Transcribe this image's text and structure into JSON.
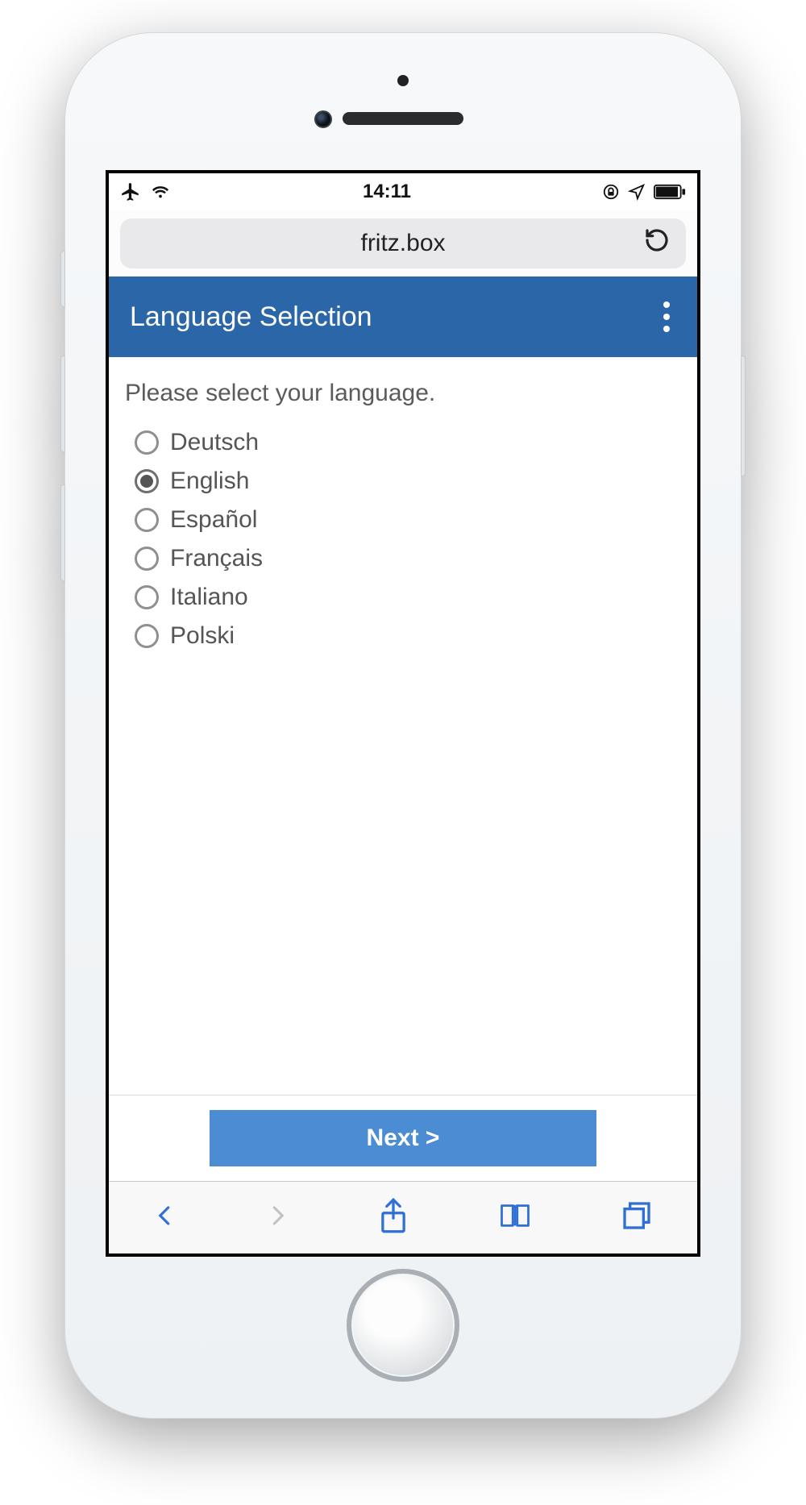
{
  "status_bar": {
    "time": "14:11"
  },
  "urlbar": {
    "host": "fritz.box"
  },
  "page": {
    "title": "Language Selection",
    "prompt": "Please select your language.",
    "next_label": "Next >"
  },
  "languages": [
    {
      "label": "Deutsch",
      "selected": false
    },
    {
      "label": "English",
      "selected": true
    },
    {
      "label": "Español",
      "selected": false
    },
    {
      "label": "Français",
      "selected": false
    },
    {
      "label": "Italiano",
      "selected": false
    },
    {
      "label": "Polski",
      "selected": false
    }
  ]
}
